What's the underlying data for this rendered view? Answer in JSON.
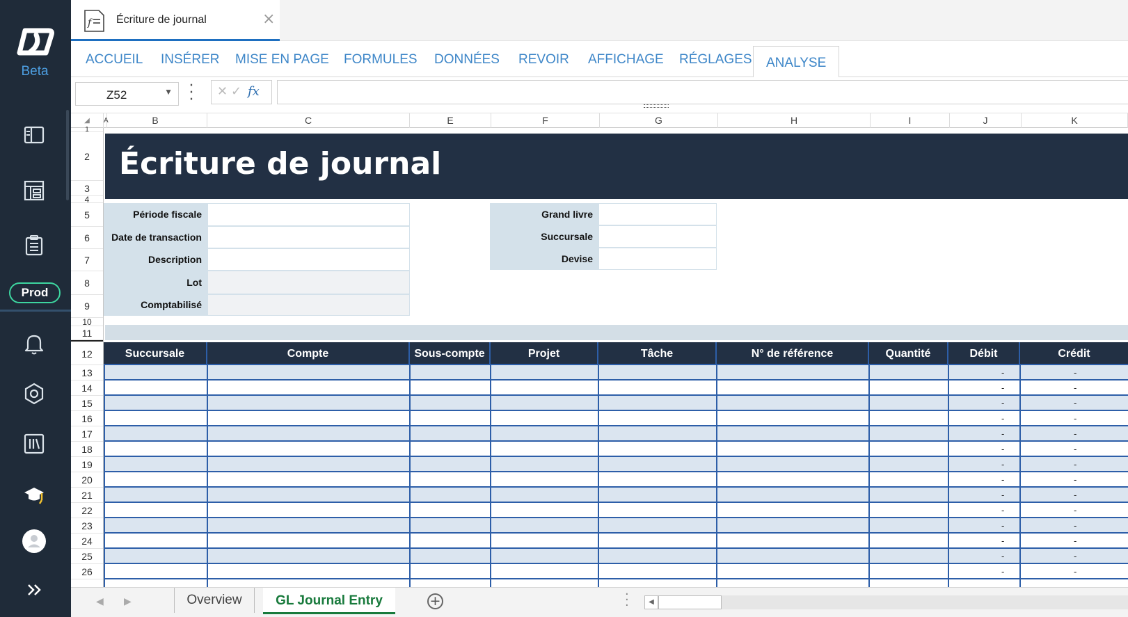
{
  "sidebar": {
    "beta_label": "Beta",
    "prod_label": "Prod",
    "icons": [
      "logo",
      "panel-icon",
      "dashboard-icon",
      "clipboard-icon",
      "bell-icon",
      "hexagon-settings-icon",
      "library-icon",
      "graduation-cap-icon",
      "user-avatar-icon",
      "expand-chevrons-icon"
    ]
  },
  "doc_tab": {
    "title": "Écriture de journal",
    "close": "×"
  },
  "ribbon": {
    "tabs": [
      "ACCUEIL",
      "INSÉRER",
      "MISE EN PAGE",
      "FORMULES",
      "DONNÉES",
      "REVOIR",
      "AFFICHAGE",
      "RÉGLAGES",
      "ANALYSE"
    ],
    "active": "ANALYSE"
  },
  "formula_bar": {
    "cell": "Z52",
    "fx": "fx",
    "formula": ""
  },
  "columns": [
    "A",
    "B",
    "C",
    "E",
    "F",
    "G",
    "H",
    "I",
    "J",
    "K"
  ],
  "rows": [
    "1",
    "2",
    "3",
    "4",
    "5",
    "6",
    "7",
    "8",
    "9",
    "10",
    "11",
    "12",
    "13",
    "14",
    "15",
    "16",
    "17",
    "18",
    "19",
    "20",
    "21",
    "22",
    "23",
    "24",
    "25",
    "26"
  ],
  "sheet": {
    "title": "Écriture de journal",
    "left_fields": {
      "periode": "Période fiscale",
      "date": "Date de transaction",
      "description": "Description",
      "lot": "Lot",
      "comptabilise": "Comptabilisé"
    },
    "right_fields": {
      "grand_livre": "Grand livre",
      "succursale": "Succursale",
      "devise": "Devise"
    },
    "table_headers": [
      "Succursale",
      "Compte",
      "Sous-compte",
      "Projet",
      "Tâche",
      "N° de référence",
      "Quantité",
      "Débit",
      "Crédit"
    ],
    "empty_value": "-"
  },
  "sheet_tabs": {
    "overview": "Overview",
    "gl": "GL Journal Entry",
    "add": "+"
  },
  "colors": {
    "sidebar": "#1f2b39",
    "accent": "#3d86c8",
    "header_band": "#223044",
    "active_sheet": "#187a3c",
    "prod_badge": "#3dd6a0"
  }
}
